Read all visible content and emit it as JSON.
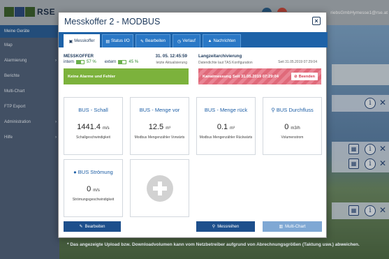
{
  "app": {
    "logo_text": "RSE",
    "user_email": "riebsGmbHymesse1@rse.at",
    "footnote": "* Das angezeigte Upload bzw. Downloadvolumen kann vom Netzbetreiber aufgrund von Abrechnungsgrößen (Taktung usw.) abweichen."
  },
  "sidebar": {
    "items": [
      {
        "label": "Meine Geräte",
        "arrow": ""
      },
      {
        "label": "Map",
        "arrow": ""
      },
      {
        "label": "Alarmierung",
        "arrow": "›"
      },
      {
        "label": "Berichte",
        "arrow": ""
      },
      {
        "label": "Multi-Chart",
        "arrow": ""
      },
      {
        "label": "FTP Export",
        "arrow": ""
      },
      {
        "label": "Administration",
        "arrow": "›"
      },
      {
        "label": "Hilfe",
        "arrow": "›"
      }
    ]
  },
  "modal": {
    "title": "Messkoffer 2 - MODBUS",
    "close_symbol": "×",
    "tabs": [
      {
        "label": "Messkoffer",
        "icon": "briefcase-icon",
        "glyph": "▣"
      },
      {
        "label": "Status I/O",
        "icon": "status-icon",
        "glyph": "▤"
      },
      {
        "label": "Bearbeiten",
        "icon": "edit-icon",
        "glyph": "✎"
      },
      {
        "label": "Verlauf",
        "icon": "history-icon",
        "glyph": "◷"
      },
      {
        "label": "Nachrichten",
        "icon": "warning-icon",
        "glyph": "▲"
      }
    ],
    "device": {
      "name": "MESSKOFFER",
      "timestamp": "31. 05. 12:45:59",
      "last_update_label": "letzte Aktualisierung",
      "intern_label": "intern",
      "intern_pct": "57 %",
      "intern_level": 0.57,
      "extern_label": "extern",
      "extern_pct": "45 %",
      "extern_level": 0.45
    },
    "archive": {
      "title": "Langzeitarchivierung",
      "subtitle": "Datendichte laut TAS Konfiguration",
      "since": "Seit 31.05.2019 07:29:04"
    },
    "alert_ok": "Keine Alarme und Fehler",
    "alert_bad": "Kanalmessung Seit 31.05.2019 07:29:04",
    "end_button": "Beenden",
    "cards": [
      {
        "title": "BUS - Schall",
        "icon": "",
        "value": "1441.4",
        "unit": "m/s",
        "desc": "Schallgeschwindigkeit"
      },
      {
        "title": "BUS - Menge vor",
        "icon": "",
        "value": "12.5",
        "unit": "m³",
        "desc": "Modbus Mengenzähler Vorwärts"
      },
      {
        "title": "BUS - Menge rück",
        "icon": "",
        "value": "0.1",
        "unit": "m³",
        "desc": "Modbus Mengenzähler Rückwärts"
      },
      {
        "title": "BUS Durchfluss",
        "icon": "tap-icon",
        "glyph": "⚲",
        "value": "0",
        "unit": "m3/h",
        "desc": "Volumenstrom"
      },
      {
        "title": "BUS Strömung",
        "icon": "drop-icon",
        "glyph": "💧",
        "value": "0",
        "unit": "m/s",
        "desc": "Strömungsgeschwindigkeit"
      }
    ],
    "buttons": {
      "edit": "Bearbeiten",
      "series": "Messreihen",
      "multichart": "Multi-Chart"
    }
  }
}
